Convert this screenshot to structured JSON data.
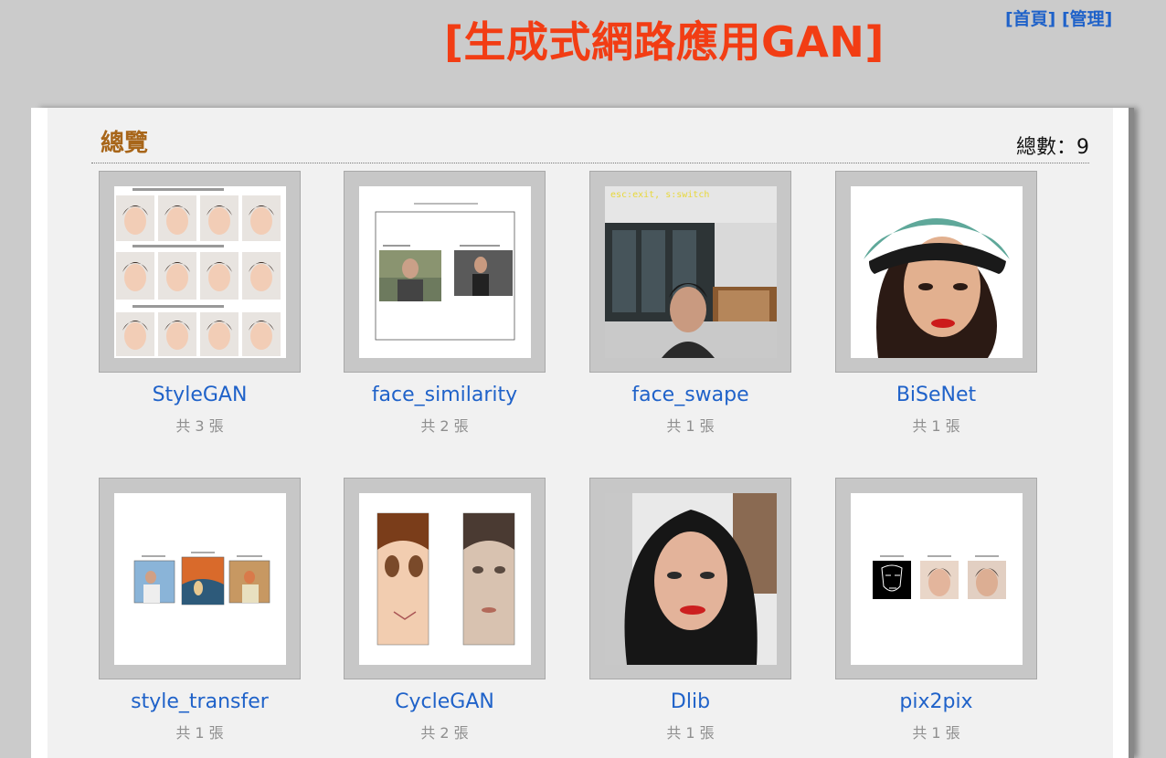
{
  "header": {
    "site_title": "[生成式網路應用GAN]",
    "nav": [
      {
        "label": "[首頁]"
      },
      {
        "label": "[管理]"
      }
    ]
  },
  "main": {
    "overview_title": "總覽",
    "total_label": "總數：9",
    "albums": [
      {
        "name": "StyleGAN",
        "count": "共 3 張"
      },
      {
        "name": "face_similarity",
        "count": "共 2 張"
      },
      {
        "name": "face_swape",
        "count": "共 1 張"
      },
      {
        "name": "BiSeNet",
        "count": "共 1 張"
      },
      {
        "name": "style_transfer",
        "count": "共 1 張"
      },
      {
        "name": "CycleGAN",
        "count": "共 2 張"
      },
      {
        "name": "Dlib",
        "count": "共 1 張"
      },
      {
        "name": "pix2pix",
        "count": "共 1 張"
      }
    ],
    "thumb_texts": {
      "face_swape_overlay": "esc:exit, s:switch"
    }
  },
  "colors": {
    "title": "#f23d14",
    "link": "#1f62c9",
    "overview": "#a8661a",
    "count": "#8f8f8f"
  }
}
